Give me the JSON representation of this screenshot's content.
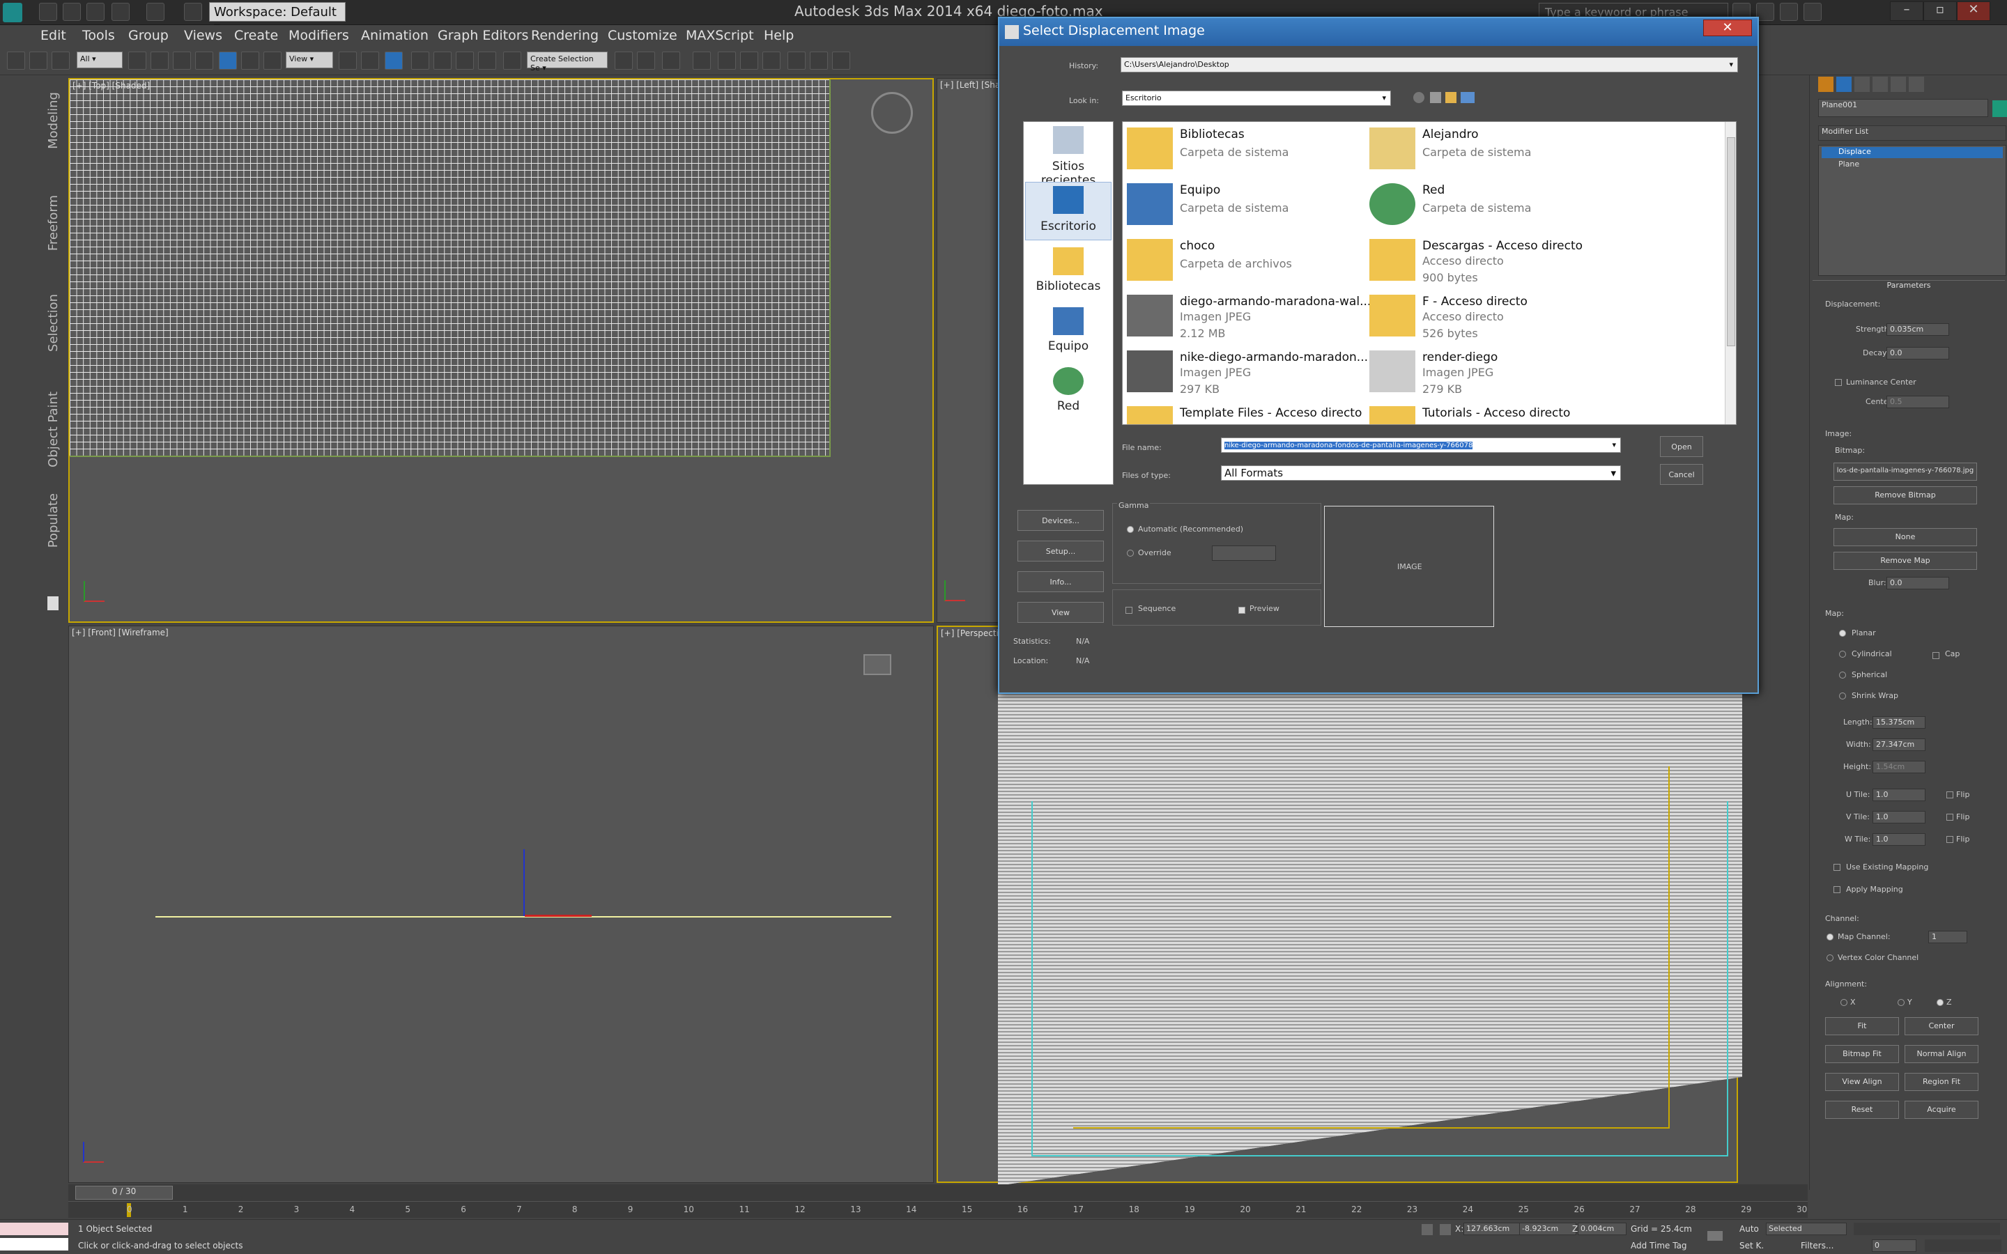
{
  "app": {
    "title": "Autodesk 3ds Max  2014 x64    diego-foto.max",
    "workspace": "Workspace: Default",
    "search_placeholder": "Type a keyword or phrase"
  },
  "menu": [
    "Edit",
    "Tools",
    "Group",
    "Views",
    "Create",
    "Modifiers",
    "Animation",
    "Graph Editors",
    "Rendering",
    "Customize",
    "MAXScript",
    "Help"
  ],
  "toolbar": {
    "filter": "All",
    "view": "View",
    "selection_set": "Create Selection Se"
  },
  "left_tabs": [
    "Modeling",
    "Freeform",
    "Selection",
    "Object Paint",
    "Populate"
  ],
  "viewports": {
    "top_left": "[+] [Top] [Shaded]",
    "top_right": "[+] [Left] [Sha",
    "bottom_left": "[+] [Front] [Wireframe]",
    "bottom_right": "[+] [Perspectiv"
  },
  "dialog": {
    "title": "Select Displacement Image",
    "history_label": "History:",
    "history_value": "C:\\Users\\Alejandro\\Desktop",
    "lookin_label": "Look in:",
    "lookin_value": "Escritorio",
    "places": [
      "Sitios recientes",
      "Escritorio",
      "Bibliotecas",
      "Equipo",
      "Red"
    ],
    "files": [
      {
        "name": "Bibliotecas",
        "lines": [
          "Carpeta de sistema"
        ]
      },
      {
        "name": "Alejandro",
        "lines": [
          "Carpeta de sistema"
        ]
      },
      {
        "name": "Equipo",
        "lines": [
          "Carpeta de sistema"
        ]
      },
      {
        "name": "Red",
        "lines": [
          "Carpeta de sistema"
        ]
      },
      {
        "name": "choco",
        "lines": [
          "Carpeta de archivos"
        ]
      },
      {
        "name": "Descargas - Acceso directo",
        "lines": [
          "Acceso directo",
          "900 bytes"
        ]
      },
      {
        "name": "diego-armando-maradona-wal...",
        "lines": [
          "Imagen JPEG",
          "2.12 MB"
        ]
      },
      {
        "name": "F - Acceso directo",
        "lines": [
          "Acceso directo",
          "526 bytes"
        ]
      },
      {
        "name": "nike-diego-armando-maradon...",
        "lines": [
          "Imagen JPEG",
          "297 KB"
        ]
      },
      {
        "name": "render-diego",
        "lines": [
          "Imagen JPEG",
          "279 KB"
        ]
      },
      {
        "name": "Template Files - Acceso directo",
        "lines": []
      },
      {
        "name": "Tutorials - Acceso directo",
        "lines": []
      }
    ],
    "filename_label": "File name:",
    "filename_value": "nike-diego-armando-maradona-fondos-de-pantalla-imagenes-y-766078",
    "filetype_label": "Files of type:",
    "filetype_value": "All Formats",
    "open": "Open",
    "cancel": "Cancel",
    "devices": "Devices...",
    "setup": "Setup...",
    "info": "Info...",
    "view": "View",
    "gamma_label": "Gamma",
    "gamma_auto": "Automatic (Recommended)",
    "gamma_override": "Override",
    "sequence": "Sequence",
    "preview": "Preview",
    "image_label": "IMAGE",
    "statistics_label": "Statistics:",
    "statistics_value": "N/A",
    "location_label": "Location:",
    "location_value": "N/A"
  },
  "command_panel": {
    "object_name": "Plane001",
    "modifier_list": "Modifier List",
    "stack": [
      "Displace",
      "Plane"
    ],
    "parameters": "Parameters",
    "displacement": "Displacement:",
    "strength_label": "Strength:",
    "strength": "0.035cm",
    "decay_label": "Decay:",
    "decay": "0.0",
    "luminance_center": "Luminance Center",
    "center_label": "Center:",
    "center": "0.5",
    "image": "Image:",
    "bitmap_label": "Bitmap:",
    "bitmap": "los-de-pantalla-imagenes-y-766078.jpg",
    "remove_bitmap": "Remove Bitmap",
    "map_label": "Map:",
    "map_none": "None",
    "remove_map": "Remove Map",
    "blur_label": "Blur:",
    "blur": "0.0",
    "map_section": "Map:",
    "planar": "Planar",
    "cylindrical": "Cylindrical",
    "cap": "Cap",
    "spherical": "Spherical",
    "shrink_wrap": "Shrink Wrap",
    "length_label": "Length:",
    "length": "15.375cm",
    "width_label": "Width:",
    "width": "27.347cm",
    "height_label": "Height:",
    "height": "1.54cm",
    "utile_label": "U Tile:",
    "utile": "1.0",
    "vtile_label": "V Tile:",
    "vtile": "1.0",
    "wtile_label": "W Tile:",
    "wtile": "1.0",
    "flip": "Flip",
    "use_existing": "Use Existing Mapping",
    "apply_mapping": "Apply Mapping",
    "channel": "Channel:",
    "map_channel": "Map Channel:",
    "map_channel_value": "1",
    "vertex_color": "Vertex Color Channel",
    "alignment": "Alignment:",
    "ax": "X",
    "ay": "Y",
    "az": "Z",
    "fit": "Fit",
    "center_btn": "Center",
    "bitmap_fit": "Bitmap Fit",
    "normal_align": "Normal Align",
    "view_align": "View Align",
    "region_fit": "Region Fit",
    "reset": "Reset",
    "acquire": "Acquire"
  },
  "timeline": {
    "frame": "0 / 30",
    "ticks": [
      "0",
      "1",
      "2",
      "3",
      "4",
      "5",
      "6",
      "7",
      "8",
      "9",
      "10",
      "11",
      "12",
      "13",
      "14",
      "15",
      "16",
      "17",
      "18",
      "19",
      "20",
      "21",
      "22",
      "23",
      "24",
      "25",
      "26",
      "27",
      "28",
      "29",
      "30"
    ]
  },
  "status": {
    "selected": "1 Object Selected",
    "prompt": "Click or click-and-drag to select objects",
    "x_label": "X:",
    "x": "127.663cm",
    "y_label": "Y:",
    "y": "-8.923cm",
    "z_label": "Z:",
    "z": "0.004cm",
    "grid": "Grid = 25.4cm",
    "add_time_tag": "Add Time Tag",
    "auto": "Auto",
    "set_key": "Set K.",
    "key_mode": "Selected",
    "filters": "Filters...",
    "frame_field": "0"
  }
}
